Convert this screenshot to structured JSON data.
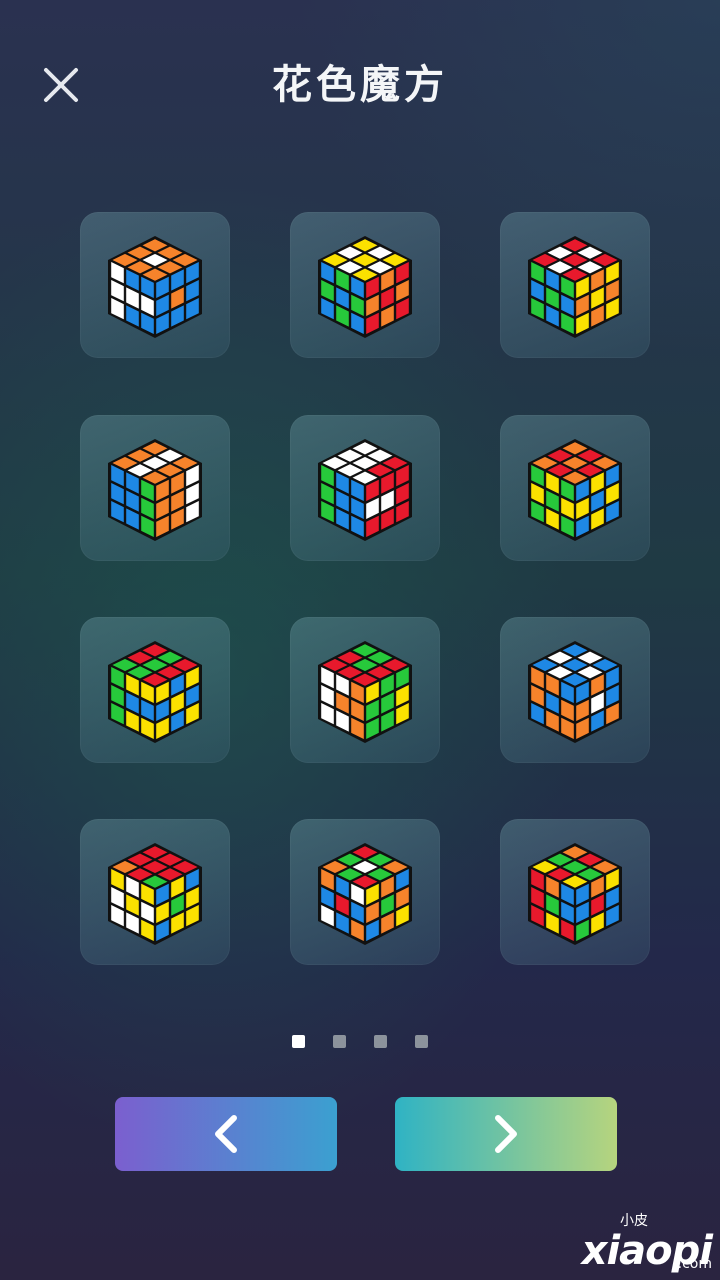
{
  "header": {
    "title": "花色魔方",
    "close_icon": "close-icon"
  },
  "colors": {
    "W": "#ffffff",
    "Y": "#fbe100",
    "R": "#e8192c",
    "O": "#f6832b",
    "B": "#1e88e5",
    "G": "#27c93b"
  },
  "patterns": [
    {
      "top": "OOOOWOOOO",
      "left": "WBBWWWWBB",
      "right": "BBBBOBBBB"
    },
    {
      "top": "YWYWYWYWY",
      "left": "BGBGBGBGB",
      "right": "ROROROROR"
    },
    {
      "top": "RWRWRWRWR",
      "left": "GBGBGBGBG",
      "right": "YOYOYOYOY"
    },
    {
      "top": "OOOWWWOOO",
      "left": "BBGBBGBBG",
      "right": "OOWOOWOOW"
    },
    {
      "top": "WWWWWWWRR",
      "left": "GBBGBBGBB",
      "right": "RRRWWRRRR"
    },
    {
      "top": "OROROROROR",
      "left": "GYGYGYGYG",
      "right": "BYBYBYBYB"
    },
    {
      "top": "GRRGGGRRR",
      "left": "GYYGBBGYY",
      "right": "YBYBYBYBY"
    },
    {
      "top": "RRGRGGRRR",
      "left": "WWOWOOWWO",
      "right": "YGGGGYGGY"
    },
    {
      "top": "BWBWBWBWB",
      "left": "OOBOBOBOO",
      "right": "BOBOWBOBO"
    },
    {
      "top": "ORRRRRGRR",
      "left": "YWYWYWWWY",
      "right": "BYBYGYBYY"
    },
    {
      "top": "OGRGWGRGO",
      "left": "OBWBRBWBO",
      "right": "YOBOGOBOY"
    },
    {
      "top": "YGORGRYGO",
      "left": "ROBRGBRYR",
      "right": "BOYBRBGYB"
    }
  ],
  "pagination": {
    "count": 4,
    "active": 0
  },
  "nav": {
    "prev_icon": "chevron-left-icon",
    "next_icon": "chevron-right-icon"
  },
  "watermark": {
    "chinese": "小皮",
    "brand": "xiaopi",
    "domain": ".com"
  }
}
